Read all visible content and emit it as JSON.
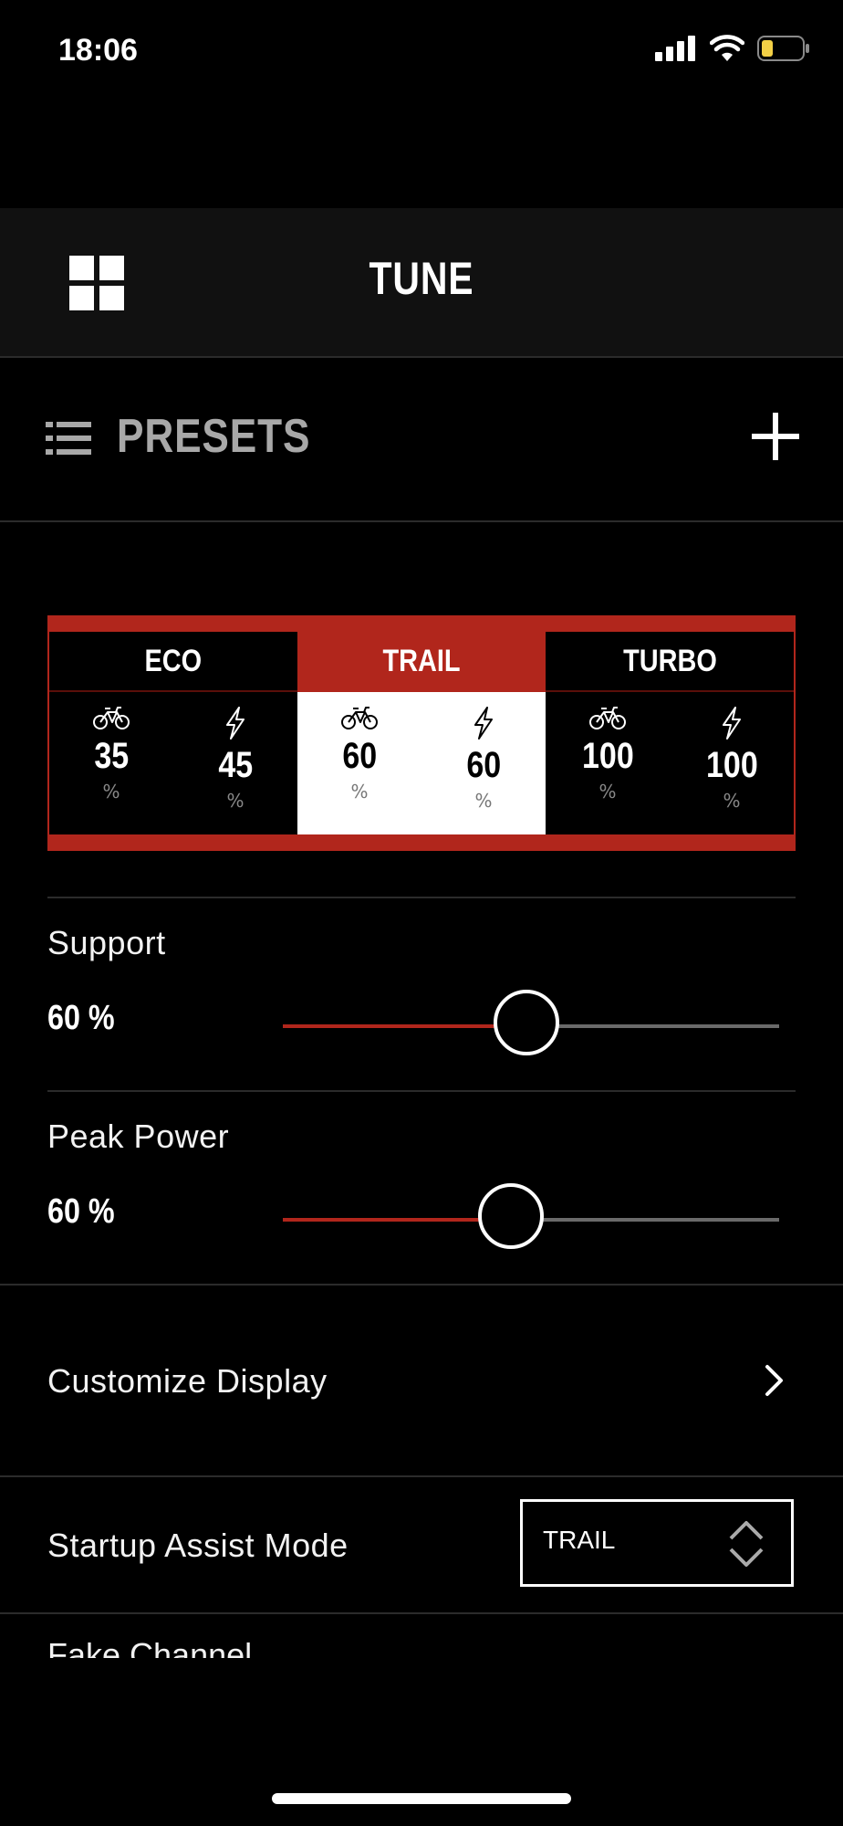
{
  "status_bar": {
    "time": "18:06"
  },
  "header": {
    "title": "TUNE"
  },
  "presets": {
    "label": "PRESETS"
  },
  "modes": [
    {
      "name": "ECO",
      "support": "35",
      "peak": "45",
      "unit": "%"
    },
    {
      "name": "TRAIL",
      "support": "60",
      "peak": "60",
      "unit": "%"
    },
    {
      "name": "TURBO",
      "support": "100",
      "peak": "100",
      "unit": "%"
    }
  ],
  "support": {
    "label": "Support",
    "value_text": "60 %",
    "value": 60
  },
  "peak_power": {
    "label": "Peak Power",
    "value_text": "60 %",
    "value": 60
  },
  "customize_display": {
    "label": "Customize Display"
  },
  "startup_assist": {
    "label": "Startup Assist Mode",
    "value": "TRAIL"
  },
  "fake_channel": {
    "label": "Fake Channel"
  },
  "colors": {
    "accent": "#b1261c",
    "background": "#000000",
    "header_bg": "#111111"
  }
}
